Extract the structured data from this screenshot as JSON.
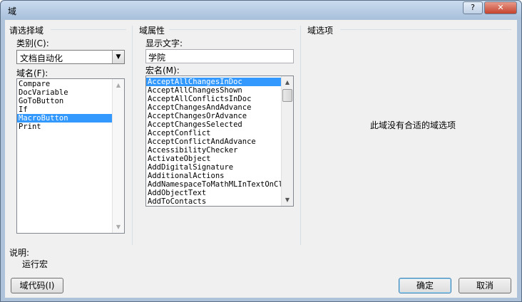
{
  "window": {
    "title": "域",
    "help_glyph": "?",
    "close_glyph": "✕"
  },
  "left": {
    "group_title": "请选择域",
    "category_label": "类别(C):",
    "category_value": "文档自动化",
    "fieldname_label": "域名(F):",
    "field_names": [
      "Compare",
      "DocVariable",
      "GoToButton",
      "If",
      "MacroButton",
      "Print"
    ],
    "selected_field": "MacroButton"
  },
  "middle": {
    "group_title": "域属性",
    "display_text_label": "显示文字:",
    "display_text_value": "学院",
    "macro_label": "宏名(M):",
    "macros": [
      "AcceptAllChangesInDoc",
      "AcceptAllChangesShown",
      "AcceptAllConflictsInDoc",
      "AcceptChangesAndAdvance",
      "AcceptChangesOrAdvance",
      "AcceptChangesSelected",
      "AcceptConflict",
      "AcceptConflictAndAdvance",
      "AccessibilityChecker",
      "ActivateObject",
      "AddDigitalSignature",
      "AdditionalActions",
      "AddNamespaceToMathMLInTextOnCli",
      "AddObjectText",
      "AddToContacts"
    ],
    "selected_macro": "AcceptAllChangesInDoc"
  },
  "right": {
    "group_title": "域选项",
    "empty_message": "此域没有合适的域选项"
  },
  "description": {
    "label": "说明:",
    "text": "运行宏"
  },
  "buttons": {
    "field_codes": "域代码(I)",
    "ok": "确定",
    "cancel": "取消"
  }
}
